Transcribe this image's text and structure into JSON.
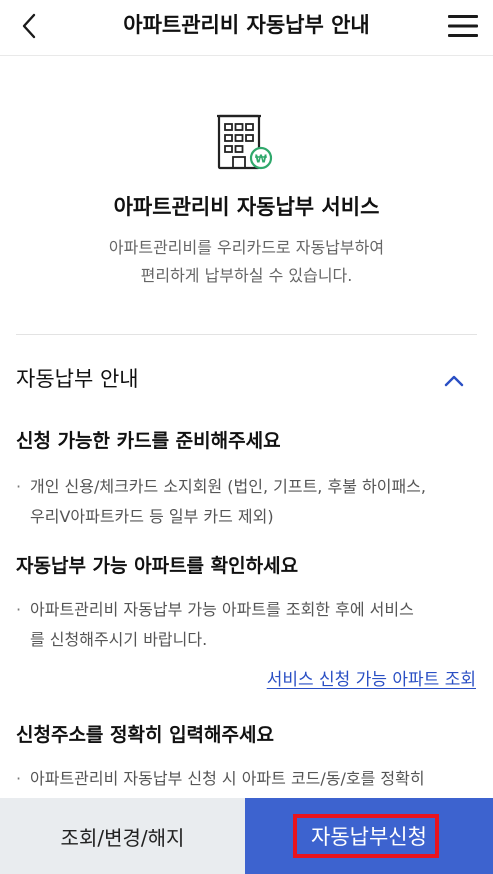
{
  "header": {
    "title": "아파트관리비 자동납부 안내",
    "back_icon": "chevron-left-icon",
    "menu_icon": "hamburger-menu-icon"
  },
  "hero": {
    "icon": "apartment-won-icon",
    "title": "아파트관리비 자동납부 서비스",
    "desc_line1": "아파트관리비를 우리카드로 자동납부하여",
    "desc_line2": "편리하게 납부하실 수 있습니다."
  },
  "guide": {
    "title": "자동납부 안내",
    "collapse_icon": "chevron-up-icon",
    "sections": [
      {
        "heading": "신청 가능한 카드를 준비해주세요",
        "line1": "개인 신용/체크카드 소지회원 (법인, 기프트, 후불 하이패스,",
        "line2": "우리V아파트카드 등 일부 카드 제외)"
      },
      {
        "heading": "자동납부 가능 아파트를 확인하세요",
        "line1": "아파트관리비 자동납부 가능 아파트를 조회한 후에 서비스",
        "line2": "를 신청해주시기 바랍니다.",
        "link": "서비스 신청 가능 아파트 조회"
      },
      {
        "heading": "신청주소를 정확히 입력해주세요",
        "line1": "아파트관리비 자동납부 신청 시 아파트 코드/동/호를 정확히"
      }
    ]
  },
  "bottom": {
    "inquiry_label": "조회/변경/해지",
    "apply_label": "자동납부신청"
  },
  "colors": {
    "primary": "#3d63cf",
    "link": "#2a4fc4",
    "highlight": "#e8141e",
    "secondary_button": "#e9ecef",
    "accent_green": "#2fa86b"
  }
}
